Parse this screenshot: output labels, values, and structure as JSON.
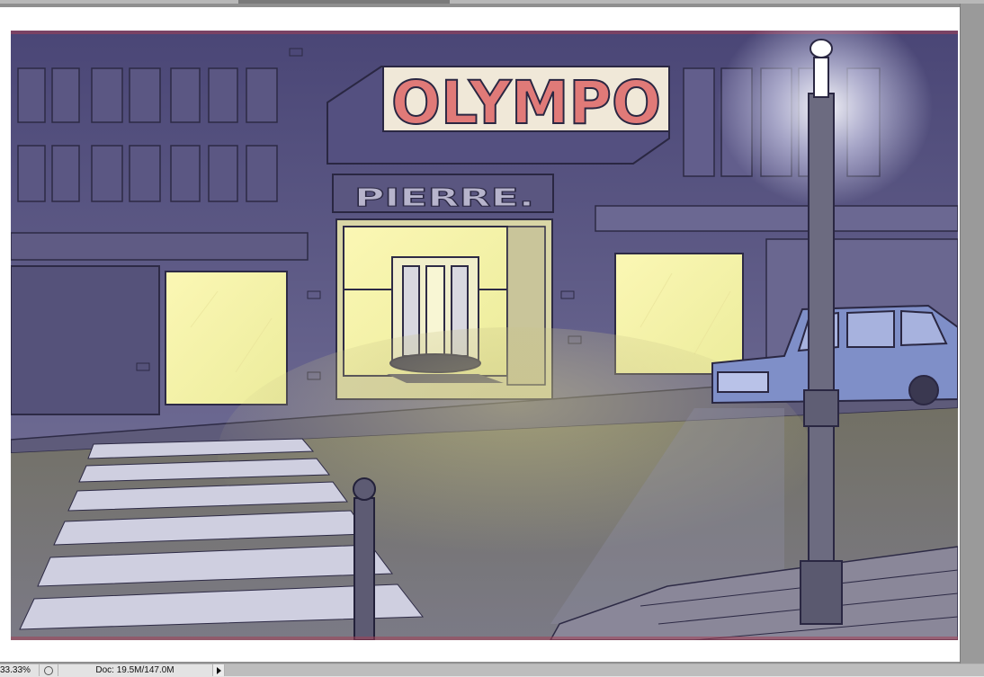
{
  "status_bar": {
    "zoom_level": "33.33%",
    "doc_size": "Doc: 19.5M/147.0M"
  },
  "artwork": {
    "marquee_sign": "OLYMPO",
    "shop_sign": "PIERRE."
  },
  "colors": {
    "night_sky": "#4b477a",
    "building_wall": "#6f6b8f",
    "window_glow": "#f6f2a6",
    "sign_red": "#e07a78",
    "car_blue": "#7f8fc8",
    "lamp_light": "#fbfbff"
  },
  "icons": [
    "preview-toggle-icon",
    "status-menu-arrow-icon"
  ]
}
